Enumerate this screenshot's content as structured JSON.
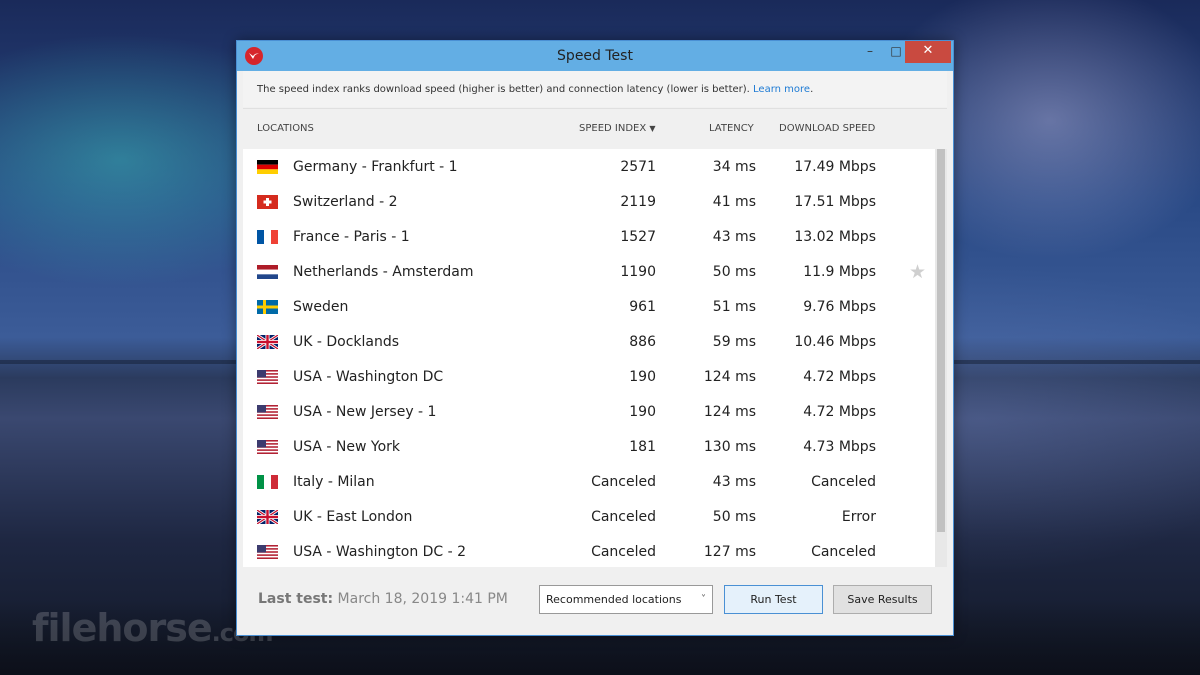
{
  "watermark": {
    "text": "filehorse",
    "suffix": ".com"
  },
  "window": {
    "title": "Speed Test",
    "minimize_label": "–",
    "maximize_label": "□",
    "close_label": "✕"
  },
  "info": {
    "text": "The speed index ranks download speed (higher is better) and connection latency (lower is better).",
    "link": "Learn more",
    "period": "."
  },
  "columns": {
    "locations": "LOCATIONS",
    "speed_index": "SPEED INDEX",
    "sort_indicator": "▼",
    "latency": "LATENCY",
    "download_speed": "DOWNLOAD SPEED"
  },
  "rows": [
    {
      "location": "Germany - Frankfurt - 1",
      "flag": "germany-flag-icon",
      "speed_index": "2571",
      "latency": "34 ms",
      "download": "17.49 Mbps"
    },
    {
      "location": "Switzerland - 2",
      "flag": "switzerland-flag-icon",
      "speed_index": "2119",
      "latency": "41 ms",
      "download": "17.51 Mbps"
    },
    {
      "location": "France - Paris - 1",
      "flag": "france-flag-icon",
      "speed_index": "1527",
      "latency": "43 ms",
      "download": "13.02 Mbps"
    },
    {
      "location": "Netherlands - Amsterdam",
      "flag": "netherlands-flag-icon",
      "speed_index": "1190",
      "latency": "50 ms",
      "download": "11.9 Mbps",
      "star": "★"
    },
    {
      "location": "Sweden",
      "flag": "sweden-flag-icon",
      "speed_index": "961",
      "latency": "51 ms",
      "download": "9.76 Mbps"
    },
    {
      "location": "UK - Docklands",
      "flag": "uk-flag-icon",
      "speed_index": "886",
      "latency": "59 ms",
      "download": "10.46 Mbps"
    },
    {
      "location": "USA - Washington DC",
      "flag": "usa-flag-icon",
      "speed_index": "190",
      "latency": "124 ms",
      "download": "4.72 Mbps"
    },
    {
      "location": "USA - New Jersey - 1",
      "flag": "usa-flag-icon",
      "speed_index": "190",
      "latency": "124 ms",
      "download": "4.72 Mbps"
    },
    {
      "location": "USA - New York",
      "flag": "usa-flag-icon",
      "speed_index": "181",
      "latency": "130 ms",
      "download": "4.73 Mbps"
    },
    {
      "location": "Italy - Milan",
      "flag": "italy-flag-icon",
      "speed_index": "Canceled",
      "latency": "43 ms",
      "download": "Canceled"
    },
    {
      "location": "UK - East London",
      "flag": "uk-flag-icon",
      "speed_index": "Canceled",
      "latency": "50 ms",
      "download": "Error"
    },
    {
      "location": "USA - Washington DC - 2",
      "flag": "usa-flag-icon",
      "speed_index": "Canceled",
      "latency": "127 ms",
      "download": "Canceled"
    }
  ],
  "footer": {
    "last_test_label": "Last test:",
    "last_test_value": "March 18, 2019 1:41 PM",
    "location_select": "Recommended locations",
    "select_chevron": "˅",
    "run_test_label": "Run Test",
    "save_results_label": "Save Results"
  },
  "colors": {
    "titlebar": "#63aee4",
    "close_button": "#c94a40",
    "link": "#1e7bd4",
    "app_icon": "#d6252b"
  }
}
